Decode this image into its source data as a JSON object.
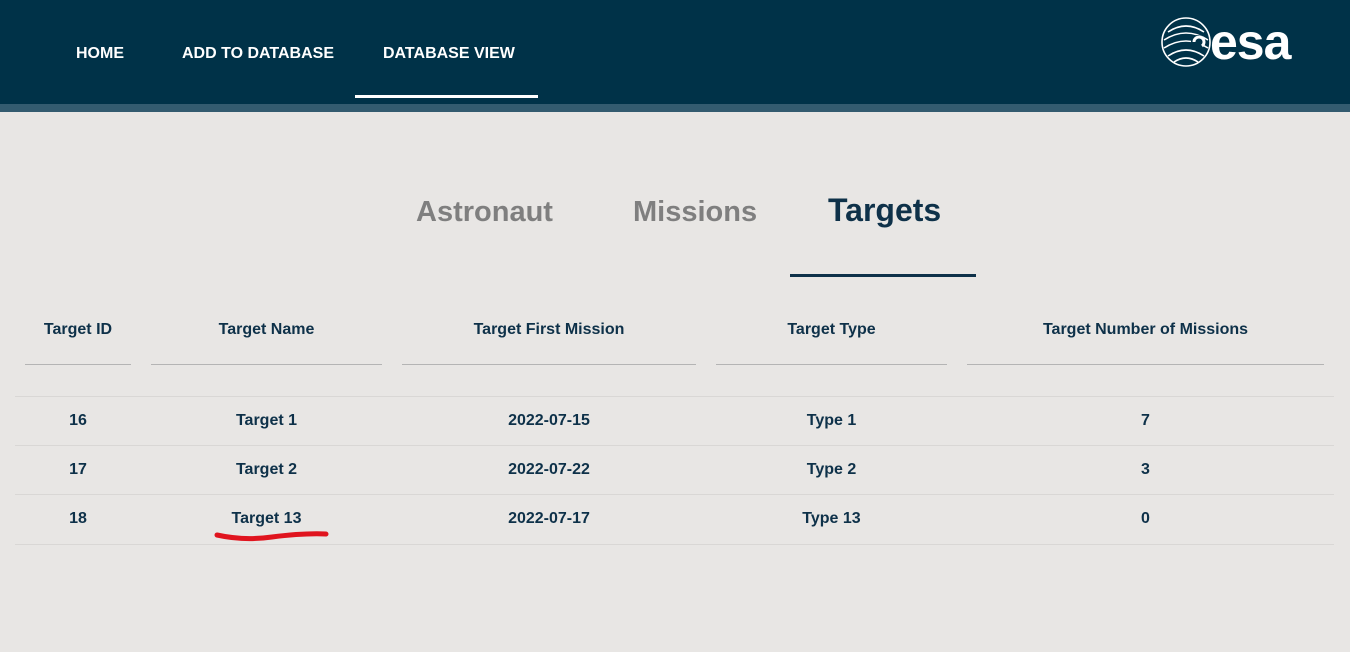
{
  "nav": {
    "home": "HOME",
    "add": "ADD TO DATABASE",
    "view": "DATABASE VIEW"
  },
  "logo": {
    "text": "esa",
    "icon": "esa-logo-icon"
  },
  "tabs": [
    {
      "label": "Astronaut",
      "active": false
    },
    {
      "label": "Missions",
      "active": false
    },
    {
      "label": "Targets",
      "active": true
    }
  ],
  "table": {
    "headers": [
      "Target ID",
      "Target Name",
      "Target First Mission",
      "Target Type",
      "Target Number of Missions"
    ],
    "rows": [
      [
        "16",
        "Target 1",
        "2022-07-15",
        "Type 1",
        "7"
      ],
      [
        "17",
        "Target 2",
        "2022-07-22",
        "Type 2",
        "3"
      ],
      [
        "18",
        "Target 13",
        "2022-07-17",
        "Type 13",
        "0"
      ]
    ]
  },
  "colors": {
    "header_bg": "#003248",
    "accent": "#0e3149",
    "annotation": "#e0141e"
  }
}
